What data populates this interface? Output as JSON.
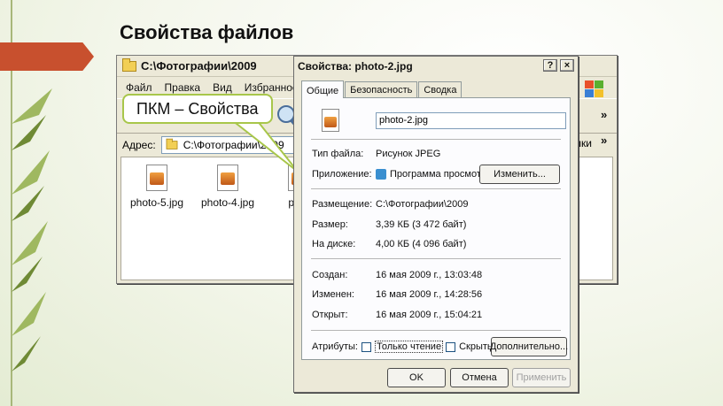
{
  "slide": {
    "title": "Свойства файлов"
  },
  "callout": {
    "text": "ПКМ – Свойства"
  },
  "explorer": {
    "title": "C:\\Фотографии\\2009",
    "menu": [
      "Файл",
      "Правка",
      "Вид",
      "Избранное"
    ],
    "address_label": "Адрес:",
    "address_value": "C:\\Фотографии\\2009",
    "chevron": "»",
    "links_label": "лки",
    "files": [
      {
        "name": "photo-5.jpg"
      },
      {
        "name": "photo-4.jpg"
      },
      {
        "name": "phot"
      }
    ]
  },
  "dialog": {
    "title": "Свойства: photo-2.jpg",
    "title_buttons": {
      "help": "?",
      "close": "×"
    },
    "tabs": [
      "Общие",
      "Безопасность",
      "Сводка"
    ],
    "filename": "photo-2.jpg",
    "filetype_label": "Тип файла:",
    "filetype_value": "Рисунок JPEG",
    "app_label": "Приложение:",
    "app_value": "Программа просмотр",
    "change_button": "Изменить...",
    "location_label": "Размещение:",
    "location_value": "C:\\Фотографии\\2009",
    "size_label": "Размер:",
    "size_value": "3,39 КБ (3 472 байт)",
    "disk_label": "На диске:",
    "disk_value": "4,00 КБ (4 096 байт)",
    "created_label": "Создан:",
    "created_value": "16 мая 2009 г., 13:03:48",
    "modified_label": "Изменен:",
    "modified_value": "16 мая 2009 г., 14:28:56",
    "opened_label": "Открыт:",
    "opened_value": "16 мая 2009 г., 15:04:21",
    "attributes_label": "Атрибуты:",
    "readonly_label": "Только чтение",
    "hidden_label": "Скрытый",
    "advanced_button": "Дополнительно...",
    "ok_button": "OK",
    "cancel_button": "Отмена",
    "apply_button": "Применить"
  },
  "colors": {
    "accent": "#a8c64a",
    "arrow": "#c8502e",
    "window": "#ece9d8"
  }
}
